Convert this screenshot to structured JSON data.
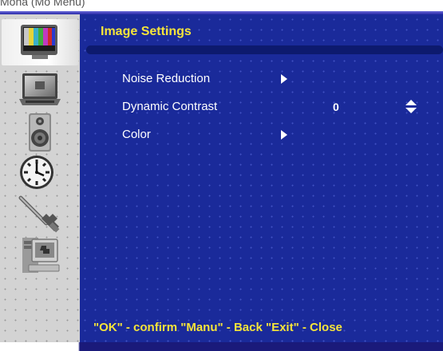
{
  "window": {
    "top_text": "Mona (Mo Menu)"
  },
  "sidebar": {
    "items": [
      {
        "name": "image-settings",
        "icon": "color-bars-tv-icon",
        "selected": true
      },
      {
        "name": "display",
        "icon": "laptop-screen-icon",
        "selected": false
      },
      {
        "name": "audio",
        "icon": "speaker-icon",
        "selected": false
      },
      {
        "name": "time",
        "icon": "clock-icon",
        "selected": false
      },
      {
        "name": "tools",
        "icon": "wrench-icon",
        "selected": false
      },
      {
        "name": "system",
        "icon": "computer-icon",
        "selected": false
      }
    ]
  },
  "main": {
    "title": "Image Settings",
    "items": [
      {
        "label": "Noise Reduction",
        "control": "submenu-arrow"
      },
      {
        "label": "Dynamic Contrast",
        "value": "0",
        "control": "up-down"
      },
      {
        "label": "Color",
        "control": "submenu-arrow"
      }
    ],
    "hint": "\"OK\" - confirm \"Manu\" - Back \"Exit\" - Close"
  },
  "colors": {
    "panel_background": "#1a2a9a",
    "title_text": "#f5e43a",
    "item_text": "#ffffff",
    "sidebar_background": "#d3d3d3"
  }
}
